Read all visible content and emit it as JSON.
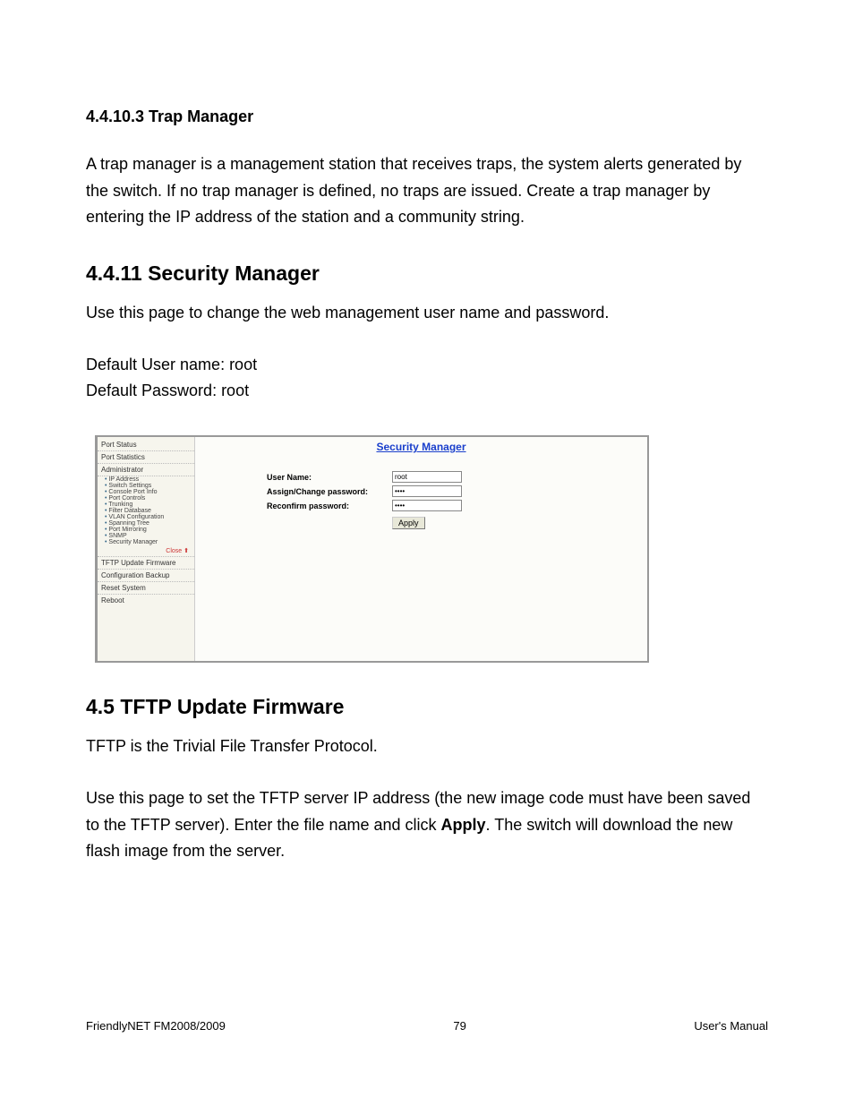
{
  "section_4_4_10_3": {
    "heading": "4.4.10.3 Trap Manager",
    "body": "A trap manager is a management station that receives traps, the system alerts generated by the switch. If no trap manager is defined, no traps are issued. Create a trap manager by entering the IP address of the station and a community string."
  },
  "section_4_4_11": {
    "heading": "4.4.11 Security Manager",
    "intro": "Use this page to change the web management user name and password.",
    "default_user_label": "Default User name: root",
    "default_pass_label": "Default Password: root"
  },
  "screenshot": {
    "sidebar": {
      "port_status": "Port Status",
      "port_statistics": "Port Statistics",
      "administrator": "Administrator",
      "items": [
        "IP Address",
        "Switch Settings",
        "Console Port Info",
        "Port Controls",
        "Trunking",
        "Filter Database",
        "VLAN Configuration",
        "Spanning Tree",
        "Port Mirroring",
        "SNMP",
        "Security Manager"
      ],
      "close": "Close ⬆",
      "tftp": "TFTP Update Firmware",
      "config_backup": "Configuration Backup",
      "reset_system": "Reset System",
      "reboot": "Reboot"
    },
    "pane": {
      "title": "Security Manager",
      "user_name_label": "User Name:",
      "user_name_value": "root",
      "assign_pw_label": "Assign/Change password:",
      "assign_pw_value": "••••",
      "reconfirm_label": "Reconfirm password:",
      "reconfirm_value": "••••",
      "apply": "Apply"
    }
  },
  "section_4_5": {
    "heading": "4.5 TFTP Update Firmware",
    "line1": "TFTP is the Trivial File Transfer Protocol.",
    "line2_pre": "Use this page to set the TFTP server IP address (the new image code must have been saved to the TFTP server). Enter the file name and click ",
    "line2_bold": "Apply",
    "line2_post": ". The switch will download the new flash image from the server."
  },
  "footer": {
    "left": "FriendlyNET FM2008/2009",
    "center": "79",
    "right": "User's Manual"
  }
}
